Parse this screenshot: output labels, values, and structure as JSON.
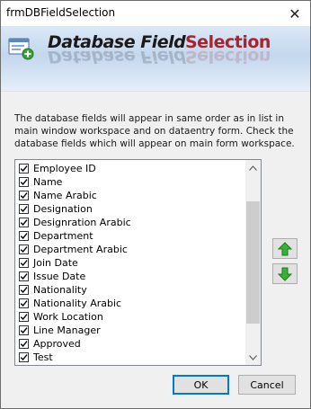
{
  "window": {
    "title": "frmDBFieldSelection",
    "close_glyph": "✕"
  },
  "banner": {
    "title_part1": "Database Field",
    "title_part2": "Selection",
    "icon": "database-add-icon",
    "accent_color": "#a8242e"
  },
  "description": "The database fields will appear in same order as in list in main window workspace and on dataentry form. Check the  database fields which will appear on main form workspace.",
  "fields": [
    {
      "label": "Employee ID",
      "checked": true
    },
    {
      "label": "Name",
      "checked": true
    },
    {
      "label": "Name Arabic",
      "checked": true
    },
    {
      "label": "Designation",
      "checked": true
    },
    {
      "label": "Designration Arabic",
      "checked": true
    },
    {
      "label": "Department",
      "checked": true
    },
    {
      "label": "Department Arabic",
      "checked": true
    },
    {
      "label": "Join Date",
      "checked": true
    },
    {
      "label": "Issue Date",
      "checked": true
    },
    {
      "label": "Nationality",
      "checked": true
    },
    {
      "label": "Nationality Arabic",
      "checked": true
    },
    {
      "label": "Work Location",
      "checked": true
    },
    {
      "label": "Line Manager",
      "checked": true
    },
    {
      "label": "Approved",
      "checked": true
    },
    {
      "label": "Test",
      "checked": true
    }
  ],
  "side_buttons": {
    "up_icon": "green-arrow-up-icon",
    "down_icon": "green-arrow-down-icon"
  },
  "buttons": {
    "ok_label": "OK",
    "cancel_label": "Cancel"
  }
}
